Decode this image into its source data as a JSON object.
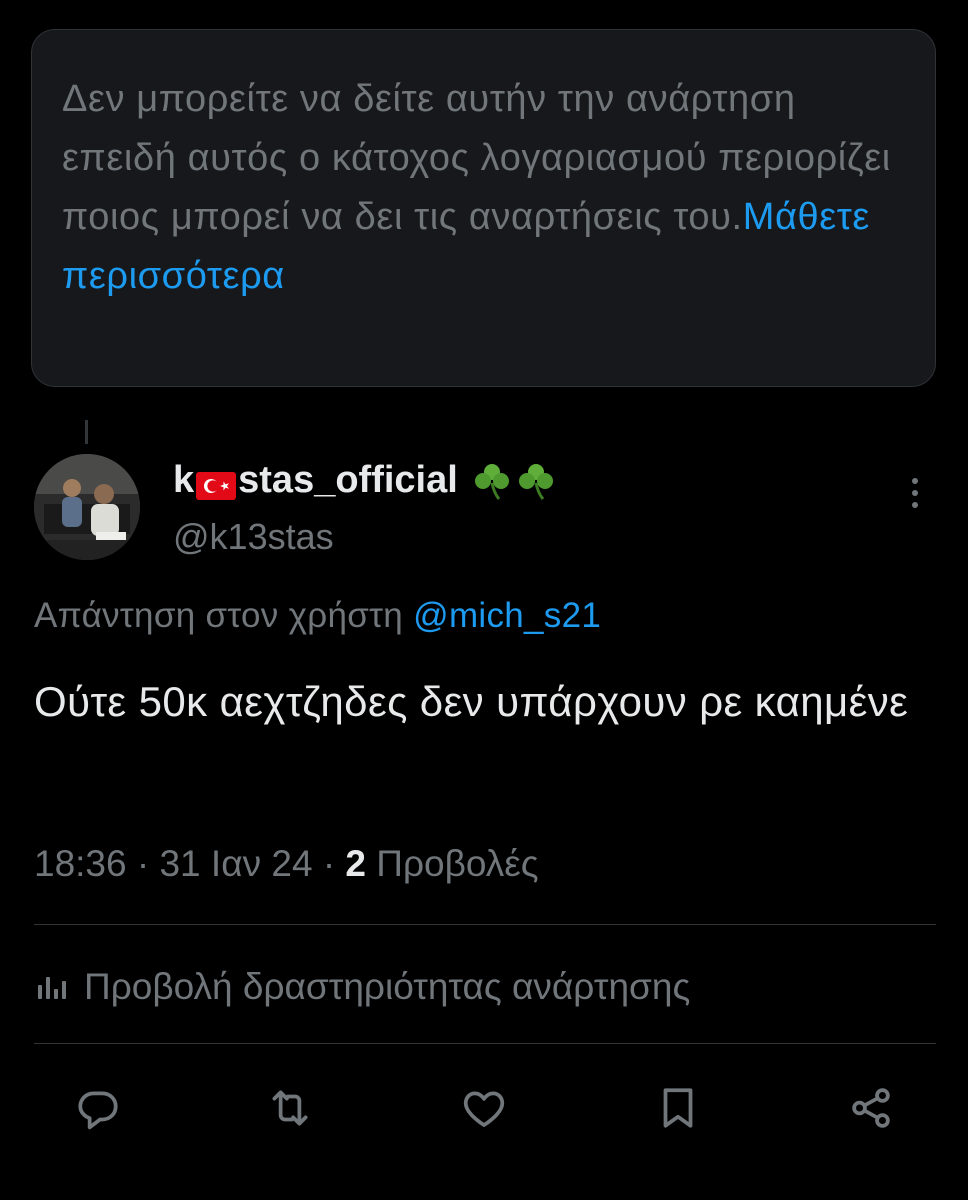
{
  "notice": {
    "text": "Δεν μπορείτε να δείτε αυτήν την ανάρτηση επειδή αυτός ο κάτοχος λογαριασμού περιορίζει ποιος μπορεί να δει τις αναρτήσεις του.",
    "link": "Μάθετε περισσότερα"
  },
  "tweet": {
    "name_prefix": "k",
    "name_suffix": "stas_official",
    "handle": "@k13stas",
    "reply_prefix": "Απάντηση στον χρήστη",
    "reply_to": "@mich_s21",
    "text": "Ούτε 50κ αεχτζηδες δεν υπάρχουν ρε καημένε",
    "time": "18:36",
    "date": "31 Ιαν 24",
    "views_count": "2",
    "views_label": "Προβολές",
    "activity_label": "Προβολή δραστηριότητας ανάρτησης"
  },
  "icons": {
    "flag": "turkey-flag-icon",
    "clovers": "shamrock-icon",
    "more": "more-vertical-icon",
    "reply": "reply-icon",
    "repost": "repost-icon",
    "like": "like-icon",
    "bookmark": "bookmark-icon",
    "share": "share-icon",
    "activity": "analytics-icon"
  },
  "colors": {
    "accent": "#1d9bf0",
    "secondary": "#71767b",
    "background": "#000000"
  }
}
